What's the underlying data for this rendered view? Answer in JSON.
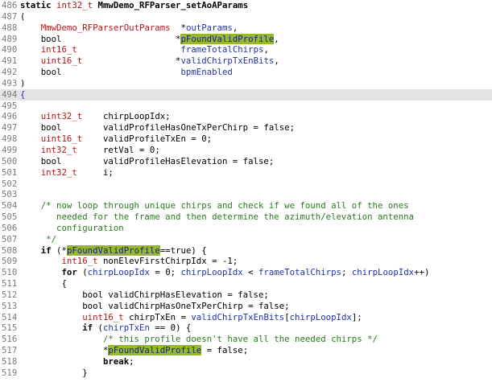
{
  "editor": {
    "highlight_color": "#96b82e",
    "current_line_color": "#e4e4e4",
    "lines": [
      {
        "n": "486",
        "t": [
          [
            "kw",
            "static "
          ],
          [
            "ty",
            "int32_t "
          ],
          [
            "kw",
            "MmwDemo_RFParser_setAoAParams"
          ]
        ]
      },
      {
        "n": "487",
        "t": [
          [
            "p",
            "("
          ]
        ]
      },
      {
        "n": "488",
        "t": [
          [
            "p",
            "    "
          ],
          [
            "ty",
            "MmwDemo_RFParserOutParams"
          ],
          [
            "p",
            "  *"
          ],
          [
            "vr",
            "outParams"
          ],
          [
            "p",
            ","
          ]
        ]
      },
      {
        "n": "489",
        "t": [
          [
            "p",
            "    bool                      *"
          ],
          [
            "hl",
            "pFoundValidProfile"
          ],
          [
            "p",
            ","
          ]
        ]
      },
      {
        "n": "490",
        "t": [
          [
            "p",
            "    "
          ],
          [
            "ty",
            "int16_t"
          ],
          [
            "p",
            "                    "
          ],
          [
            "vr",
            "frameTotalChirps"
          ],
          [
            "p",
            ","
          ]
        ]
      },
      {
        "n": "491",
        "t": [
          [
            "p",
            "    "
          ],
          [
            "ty",
            "uint16_t"
          ],
          [
            "p",
            "                  *"
          ],
          [
            "vr",
            "validChirpTxEnBits"
          ],
          [
            "p",
            ","
          ]
        ]
      },
      {
        "n": "492",
        "t": [
          [
            "p",
            "    bool                       "
          ],
          [
            "vr",
            "bpmEnabled"
          ]
        ]
      },
      {
        "n": "493",
        "t": [
          [
            "p",
            ")"
          ]
        ]
      },
      {
        "n": "494",
        "t": [
          [
            "vr",
            "{"
          ]
        ],
        "cur": true
      },
      {
        "n": "495",
        "t": []
      },
      {
        "n": "496",
        "t": [
          [
            "p",
            "    "
          ],
          [
            "ty",
            "uint32_t"
          ],
          [
            "p",
            "    chirpLoopIdx;"
          ]
        ]
      },
      {
        "n": "497",
        "t": [
          [
            "p",
            "    bool        validProfileHasOneTxPerChirp = false;"
          ]
        ]
      },
      {
        "n": "498",
        "t": [
          [
            "p",
            "    "
          ],
          [
            "ty",
            "uint16_t"
          ],
          [
            "p",
            "    validProfileTxEn = 0;"
          ]
        ]
      },
      {
        "n": "499",
        "t": [
          [
            "p",
            "    "
          ],
          [
            "ty",
            "int32_t"
          ],
          [
            "p",
            "     retVal = 0;"
          ]
        ]
      },
      {
        "n": "500",
        "t": [
          [
            "p",
            "    bool        validProfileHasElevation = false;"
          ]
        ]
      },
      {
        "n": "501",
        "t": [
          [
            "p",
            "    "
          ],
          [
            "ty",
            "int32_t"
          ],
          [
            "p",
            "     i;"
          ]
        ]
      },
      {
        "n": "502",
        "t": []
      },
      {
        "n": "503",
        "t": []
      },
      {
        "n": "504",
        "t": [
          [
            "cm",
            "    /* now loop through unique chirps and check if we found all of the ones"
          ]
        ]
      },
      {
        "n": "505",
        "t": [
          [
            "cm",
            "       needed for the frame and then determine the azimuth/elevation antenna"
          ]
        ]
      },
      {
        "n": "506",
        "t": [
          [
            "cm",
            "       configuration"
          ]
        ]
      },
      {
        "n": "507",
        "t": [
          [
            "cm",
            "     */"
          ]
        ]
      },
      {
        "n": "508",
        "t": [
          [
            "p",
            "    "
          ],
          [
            "kw",
            "if"
          ],
          [
            "p",
            " (*"
          ],
          [
            "hl",
            "pFoundValidProfile"
          ],
          [
            "p",
            "==true) {"
          ]
        ]
      },
      {
        "n": "509",
        "t": [
          [
            "p",
            "        "
          ],
          [
            "ty",
            "int16_t"
          ],
          [
            "p",
            " nonElevFirstChirpIdx = -1;"
          ]
        ]
      },
      {
        "n": "510",
        "t": [
          [
            "p",
            "        "
          ],
          [
            "kw",
            "for"
          ],
          [
            "p",
            " ("
          ],
          [
            "vr",
            "chirpLoopIdx"
          ],
          [
            "p",
            " = 0; "
          ],
          [
            "vr",
            "chirpLoopIdx"
          ],
          [
            "p",
            " < "
          ],
          [
            "vr",
            "frameTotalChirps"
          ],
          [
            "p",
            "; "
          ],
          [
            "vr",
            "chirpLoopIdx"
          ],
          [
            "p",
            "++)"
          ]
        ]
      },
      {
        "n": "511",
        "t": [
          [
            "p",
            "        {"
          ]
        ]
      },
      {
        "n": "512",
        "t": [
          [
            "p",
            "            bool validChirpHasElevation = false;"
          ]
        ]
      },
      {
        "n": "513",
        "t": [
          [
            "p",
            "            bool validChirpHasOneTxPerChirp = false;"
          ]
        ]
      },
      {
        "n": "514",
        "t": [
          [
            "p",
            "            "
          ],
          [
            "ty",
            "uint16_t"
          ],
          [
            "p",
            " chirpTxEn = "
          ],
          [
            "vr",
            "validChirpTxEnBits"
          ],
          [
            "p",
            "["
          ],
          [
            "vr",
            "chirpLoopIdx"
          ],
          [
            "p",
            "];"
          ]
        ]
      },
      {
        "n": "515",
        "t": [
          [
            "p",
            "            "
          ],
          [
            "kw",
            "if"
          ],
          [
            "p",
            " ("
          ],
          [
            "vr",
            "chirpTxEn"
          ],
          [
            "p",
            " == 0) {"
          ]
        ]
      },
      {
        "n": "516",
        "t": [
          [
            "p",
            "                "
          ],
          [
            "cm",
            "/* this profile doesn't have all the needed chirps */"
          ]
        ]
      },
      {
        "n": "517",
        "t": [
          [
            "p",
            "                *"
          ],
          [
            "hl",
            "pFoundValidProfile"
          ],
          [
            "p",
            " = false;"
          ]
        ]
      },
      {
        "n": "518",
        "t": [
          [
            "p",
            "                "
          ],
          [
            "kw",
            "break"
          ],
          [
            "p",
            ";"
          ]
        ]
      },
      {
        "n": "519",
        "t": [
          [
            "p",
            "            }"
          ]
        ]
      }
    ]
  }
}
